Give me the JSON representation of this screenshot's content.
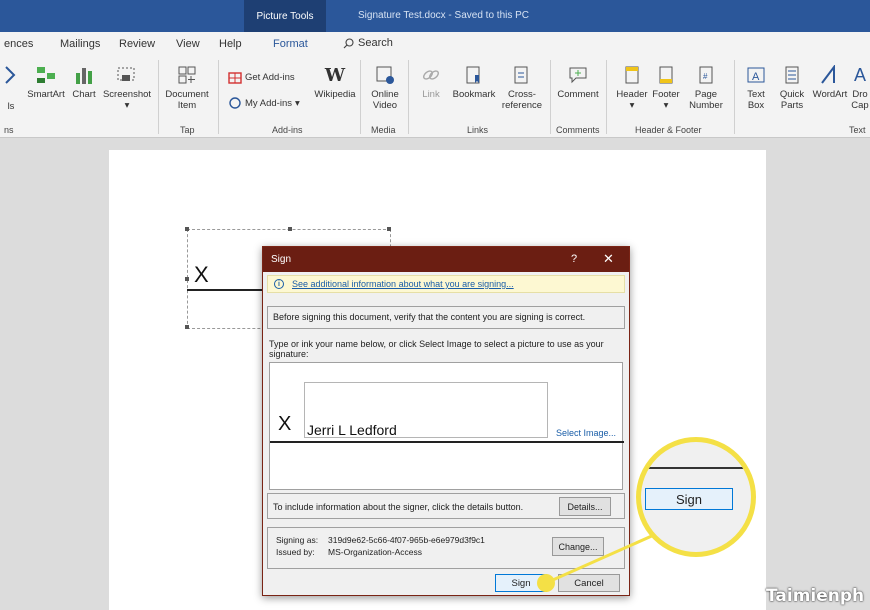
{
  "titlebar": {
    "context_tab": "Picture Tools",
    "doc_title": "Signature Test.docx  -  Saved to this PC"
  },
  "menu": {
    "tabs": [
      "ences",
      "Mailings",
      "Review",
      "View",
      "Help",
      "Format"
    ],
    "active_tab": "Format",
    "search": "Search"
  },
  "ribbon": {
    "partial_left": "ls",
    "smartart": "SmartArt",
    "chart": "Chart",
    "screenshot": "Screenshot",
    "document_item_1": "Document",
    "document_item_2": "Item",
    "get_addins": "Get Add-ins",
    "wikipedia": "Wikipedia",
    "my_addins": "My Add-ins",
    "online_video_1": "Online",
    "online_video_2": "Video",
    "link": "Link",
    "bookmark": "Bookmark",
    "cross_ref_1": "Cross-",
    "cross_ref_2": "reference",
    "comment": "Comment",
    "header": "Header",
    "footer": "Footer",
    "page_number_1": "Page",
    "page_number_2": "Number",
    "text_box_1": "Text",
    "text_box_2": "Box",
    "quick_parts_1": "Quick",
    "quick_parts_2": "Parts",
    "wordart": "WordArt",
    "drop_cap_1": "Dro",
    "drop_cap_2": "Cap",
    "groups": {
      "ns": "ns",
      "tap": "Tap",
      "addins": "Add-ins",
      "media": "Media",
      "links": "Links",
      "comments": "Comments",
      "header_footer": "Header & Footer",
      "text": "Text"
    }
  },
  "document": {
    "sig_x": "X"
  },
  "dialog": {
    "title": "Sign",
    "help": "?",
    "close": "✕",
    "info_link": "See additional information about what you are signing...",
    "verify_text": "Before signing this document, verify that the content you are signing is correct.",
    "type_label": "Type or ink your name below, or click Select Image to select a picture to use as your signature:",
    "sig_x": "X",
    "sig_name": "Jerri L Ledford",
    "select_image": "Select Image...",
    "details_text": "To include information about the signer, click the details button.",
    "details_button": "Details...",
    "signing_as_label": "Signing as:",
    "signing_as_value": "319d9e62-5c66-4f07-965b-e6e979d3f9c1",
    "issued_by_label": "Issued by:",
    "issued_by_value": "MS-Organization-Access",
    "change_button": "Change...",
    "sign_button": "Sign",
    "cancel_button": "Cancel"
  },
  "callout": {
    "sign_button": "Sign",
    "color": "#f4e046"
  },
  "watermark": "Taimienph"
}
